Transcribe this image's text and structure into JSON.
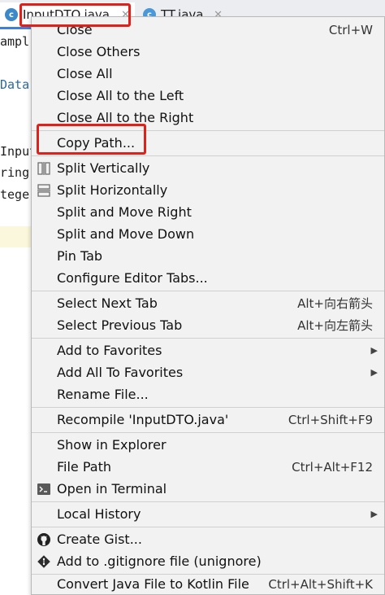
{
  "tabs": [
    {
      "name": "InputDTO.java",
      "icon_letter": "c"
    },
    {
      "name": "TT.java",
      "icon_letter": "c"
    }
  ],
  "code_fragments": [
    "ampl",
    "Data",
    "Input",
    "ring",
    "tege"
  ],
  "menu": {
    "close": {
      "label": "Close",
      "shortcut": "Ctrl+W"
    },
    "close_others": {
      "label": "Close Others"
    },
    "close_all": {
      "label": "Close All"
    },
    "close_left": {
      "label": "Close All to the Left"
    },
    "close_right": {
      "label": "Close All to the Right"
    },
    "copy_path": {
      "label": "Copy Path..."
    },
    "split_vertically": {
      "label": "Split Vertically"
    },
    "split_horizontally": {
      "label": "Split Horizontally"
    },
    "split_move_right": {
      "label": "Split and Move Right"
    },
    "split_move_down": {
      "label": "Split and Move Down"
    },
    "pin_tab": {
      "label": "Pin Tab"
    },
    "configure_tabs": {
      "label": "Configure Editor Tabs..."
    },
    "select_next_tab": {
      "label": "Select Next Tab",
      "shortcut": "Alt+向右箭头"
    },
    "select_prev_tab": {
      "label": "Select Previous Tab",
      "shortcut": "Alt+向左箭头"
    },
    "add_favorites": {
      "label": "Add to Favorites"
    },
    "add_all_favorites": {
      "label": "Add All To Favorites"
    },
    "rename_file": {
      "label": "Rename File..."
    },
    "recompile": {
      "label": "Recompile 'InputDTO.java'",
      "shortcut": "Ctrl+Shift+F9"
    },
    "show_explorer": {
      "label": "Show in Explorer"
    },
    "file_path": {
      "label": "File Path",
      "shortcut": "Ctrl+Alt+F12"
    },
    "open_terminal": {
      "label": "Open in Terminal"
    },
    "local_history": {
      "label": "Local History"
    },
    "create_gist": {
      "label": "Create Gist..."
    },
    "add_gitignore": {
      "label": "Add to .gitignore file (unignore)"
    },
    "convert_kotlin": {
      "label": "Convert Java File to Kotlin File",
      "shortcut": "Ctrl+Alt+Shift+K"
    }
  },
  "colors": {
    "highlight_border": "#e2201a",
    "menu_bg": "#f2f2f2"
  }
}
